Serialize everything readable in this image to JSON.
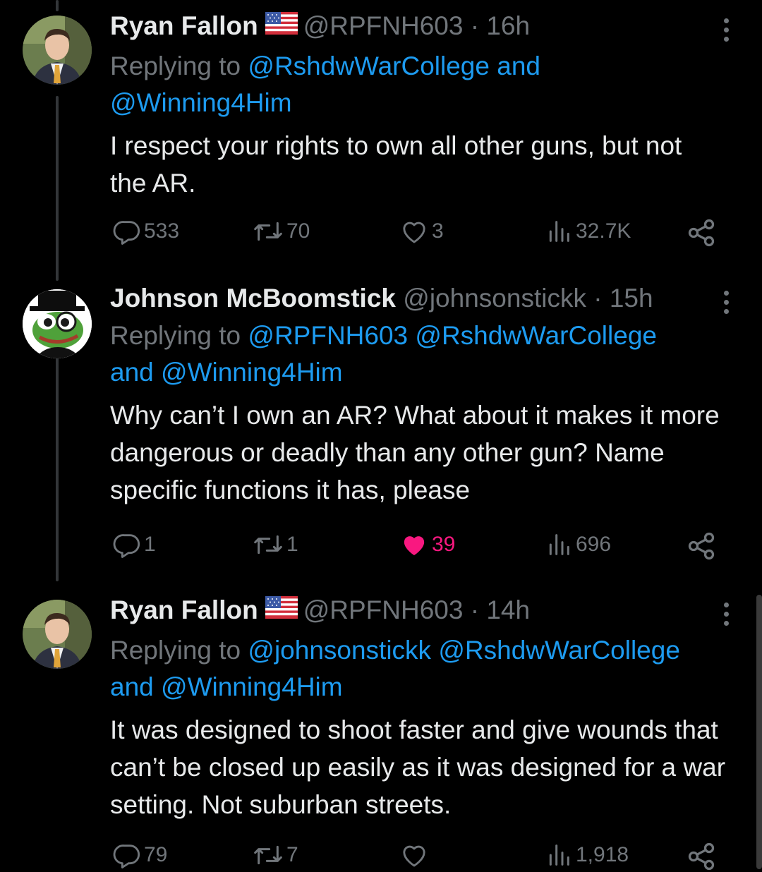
{
  "tweets": [
    {
      "name": "Ryan Fallon",
      "has_flag": true,
      "handle": "@RPFNH603",
      "time": "16h",
      "replying_label": "Replying to",
      "mentions_line1": "@RshdwWarCollege and",
      "mentions_line2": "@Winning4Him",
      "text": "I respect your rights to own all other guns, but not the AR.",
      "stats": {
        "replies": "533",
        "retweets": "70",
        "likes": "3",
        "views": "32.7K"
      },
      "liked": false
    },
    {
      "name": "Johnson McBoomstick",
      "has_flag": false,
      "handle": "@johnsonstickk",
      "time": "15h",
      "replying_label": "Replying to",
      "mentions_line1": "@RPFNH603 @RshdwWarCollege",
      "mentions_line2": "and @Winning4Him",
      "text": "Why can’t I own an AR? What about it makes it more dangerous or deadly than any other gun? Name specific functions it has, please",
      "stats": {
        "replies": "1",
        "retweets": "1",
        "likes": "39",
        "views": "696"
      },
      "liked": true
    },
    {
      "name": "Ryan Fallon",
      "has_flag": true,
      "handle": "@RPFNH603",
      "time": "14h",
      "replying_label": "Replying to",
      "mentions_line1": "@johnsonstickk @RshdwWarCollege",
      "mentions_line2": "and @Winning4Him",
      "text": "It was designed to shoot faster and give wounds that can’t be closed up easily as it was designed for a war setting. Not suburban streets.",
      "stats": {
        "replies": "79",
        "retweets": "7",
        "likes": "",
        "views": "1,918"
      },
      "liked": false
    }
  ],
  "colors": {
    "background": "#000000",
    "primary_text": "#e7e9ea",
    "secondary_text": "#71767b",
    "link": "#1d9bf0",
    "like": "#f91880",
    "thread_line": "#333639"
  },
  "icons": [
    "reply-icon",
    "retweet-icon",
    "heart-icon",
    "views-icon",
    "share-icon",
    "more-icon",
    "us-flag-icon"
  ]
}
